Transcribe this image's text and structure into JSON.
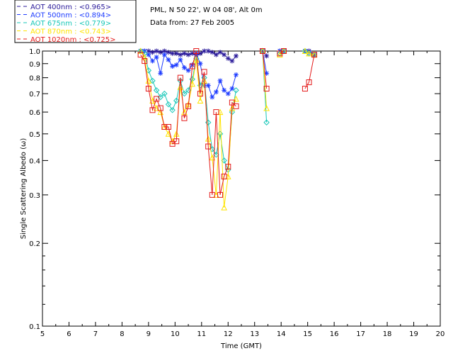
{
  "chart_data": {
    "type": "line",
    "title_lines": [
      "PML, N 50 22', W 04 08', Alt 0m",
      "Data from: 27 Feb 2005"
    ],
    "xlabel": "Time (GMT)",
    "ylabel": "Single Scattering Albedo (ω)",
    "xlim": [
      5,
      20
    ],
    "ylim": [
      0.1,
      1.0
    ],
    "yscale": "log",
    "xticks": [
      "5",
      "6",
      "7",
      "8",
      "9",
      "10",
      "11",
      "12",
      "13",
      "14",
      "15",
      "16",
      "17",
      "18",
      "19",
      "20"
    ],
    "yticks": [
      "0.1",
      "0.2",
      "0.3",
      "0.4",
      "0.5",
      "0.6",
      "0.7",
      "0.8",
      "0.9",
      "1.0"
    ],
    "legend_position": "top-left",
    "series": [
      {
        "name": "AOT  400nm : <0.965>",
        "color": "#2a1a9a",
        "marker": "asterisk",
        "segments": [
          [
            [
              8.7,
              1.0
            ],
            [
              8.85,
              1.0
            ],
            [
              9.0,
              1.0
            ],
            [
              9.15,
              0.99
            ],
            [
              9.3,
              1.0
            ],
            [
              9.45,
              0.99
            ],
            [
              9.6,
              1.0
            ],
            [
              9.75,
              0.99
            ],
            [
              9.9,
              0.98
            ],
            [
              10.05,
              0.98
            ],
            [
              10.2,
              0.97
            ],
            [
              10.35,
              0.98
            ],
            [
              10.5,
              0.97
            ],
            [
              10.65,
              0.98
            ],
            [
              10.8,
              0.97
            ],
            [
              10.95,
              0.98
            ],
            [
              11.1,
              1.0
            ],
            [
              11.25,
              1.0
            ],
            [
              11.4,
              0.99
            ],
            [
              11.55,
              0.97
            ],
            [
              11.7,
              0.99
            ],
            [
              11.85,
              0.97
            ],
            [
              12.0,
              0.94
            ],
            [
              12.15,
              0.92
            ],
            [
              12.3,
              0.96
            ]
          ],
          [
            [
              13.3,
              1.0
            ],
            [
              13.45,
              0.96
            ]
          ],
          [
            [
              13.95,
              1.0
            ],
            [
              14.1,
              1.0
            ]
          ],
          [
            [
              14.9,
              1.0
            ],
            [
              15.05,
              1.0
            ],
            [
              15.25,
              0.97
            ]
          ]
        ]
      },
      {
        "name": "AOT  500nm : <0.894>",
        "color": "#1e3cff",
        "marker": "asterisk",
        "segments": [
          [
            [
              8.7,
              1.0
            ],
            [
              8.85,
              1.0
            ],
            [
              9.0,
              0.97
            ],
            [
              9.15,
              0.92
            ],
            [
              9.3,
              0.95
            ],
            [
              9.45,
              0.83
            ],
            [
              9.6,
              0.97
            ],
            [
              9.75,
              0.93
            ],
            [
              9.9,
              0.88
            ],
            [
              10.05,
              0.89
            ],
            [
              10.2,
              0.93
            ],
            [
              10.35,
              0.87
            ],
            [
              10.5,
              0.85
            ],
            [
              10.65,
              0.89
            ],
            [
              10.8,
              0.98
            ],
            [
              10.95,
              0.9
            ],
            [
              11.1,
              0.75
            ],
            [
              11.25,
              0.75
            ],
            [
              11.4,
              0.68
            ],
            [
              11.55,
              0.71
            ],
            [
              11.7,
              0.78
            ],
            [
              11.85,
              0.72
            ],
            [
              12.0,
              0.7
            ],
            [
              12.15,
              0.73
            ],
            [
              12.3,
              0.82
            ]
          ],
          [
            [
              13.3,
              1.0
            ],
            [
              13.45,
              0.83
            ]
          ],
          [
            [
              13.95,
              1.0
            ],
            [
              14.1,
              1.0
            ]
          ],
          [
            [
              14.9,
              1.0
            ],
            [
              15.05,
              0.99
            ],
            [
              15.25,
              0.97
            ]
          ]
        ]
      },
      {
        "name": "AOT  675nm : <0.779>",
        "color": "#17c7b8",
        "marker": "diamond",
        "segments": [
          [
            [
              8.7,
              1.0
            ],
            [
              8.85,
              0.98
            ],
            [
              9.0,
              0.85
            ],
            [
              9.15,
              0.78
            ],
            [
              9.3,
              0.72
            ],
            [
              9.45,
              0.68
            ],
            [
              9.6,
              0.7
            ],
            [
              9.75,
              0.64
            ],
            [
              9.9,
              0.61
            ],
            [
              10.05,
              0.66
            ],
            [
              10.2,
              0.78
            ],
            [
              10.35,
              0.7
            ],
            [
              10.5,
              0.72
            ],
            [
              10.65,
              0.79
            ],
            [
              10.8,
              0.94
            ],
            [
              10.95,
              0.75
            ],
            [
              11.1,
              0.8
            ],
            [
              11.25,
              0.55
            ],
            [
              11.4,
              0.44
            ],
            [
              11.55,
              0.42
            ],
            [
              11.7,
              0.5
            ],
            [
              11.85,
              0.4
            ],
            [
              12.0,
              0.37
            ],
            [
              12.15,
              0.6
            ],
            [
              12.3,
              0.72
            ]
          ],
          [
            [
              13.3,
              1.0
            ],
            [
              13.45,
              0.55
            ]
          ],
          [
            [
              13.95,
              0.98
            ],
            [
              14.1,
              1.0
            ]
          ],
          [
            [
              14.9,
              1.0
            ],
            [
              15.05,
              0.98
            ],
            [
              15.25,
              0.97
            ]
          ]
        ]
      },
      {
        "name": "AOT  870nm : <0.743>",
        "color": "#ffe400",
        "marker": "triangle",
        "segments": [
          [
            [
              8.7,
              1.0
            ],
            [
              8.85,
              0.95
            ],
            [
              9.0,
              0.78
            ],
            [
              9.15,
              0.66
            ],
            [
              9.3,
              0.62
            ],
            [
              9.45,
              0.6
            ],
            [
              9.6,
              0.53
            ],
            [
              9.75,
              0.5
            ],
            [
              9.9,
              0.47
            ],
            [
              10.05,
              0.5
            ],
            [
              10.2,
              0.74
            ],
            [
              10.35,
              0.6
            ],
            [
              10.5,
              0.64
            ],
            [
              10.65,
              0.76
            ],
            [
              10.8,
              0.93
            ],
            [
              10.95,
              0.66
            ],
            [
              11.1,
              0.78
            ],
            [
              11.25,
              0.48
            ],
            [
              11.4,
              0.41
            ],
            [
              11.55,
              0.3
            ],
            [
              11.7,
              0.6
            ],
            [
              11.85,
              0.27
            ],
            [
              12.0,
              0.35
            ],
            [
              12.15,
              0.62
            ],
            [
              12.3,
              0.67
            ]
          ],
          [
            [
              13.3,
              1.0
            ],
            [
              13.45,
              0.62
            ]
          ],
          [
            [
              13.95,
              0.97
            ],
            [
              14.1,
              1.0
            ]
          ],
          [
            [
              14.9,
              1.0
            ],
            [
              15.05,
              0.98
            ],
            [
              15.25,
              0.97
            ]
          ]
        ]
      },
      {
        "name": "AOT 1020nm : <0.725>",
        "color": "#e41a1a",
        "marker": "square",
        "segments": [
          [
            [
              8.7,
              0.97
            ],
            [
              8.85,
              0.92
            ],
            [
              9.0,
              0.73
            ],
            [
              9.15,
              0.61
            ],
            [
              9.3,
              0.67
            ],
            [
              9.45,
              0.62
            ],
            [
              9.6,
              0.53
            ],
            [
              9.75,
              0.53
            ],
            [
              9.9,
              0.46
            ],
            [
              10.05,
              0.47
            ],
            [
              10.2,
              0.8
            ],
            [
              10.35,
              0.57
            ],
            [
              10.5,
              0.63
            ],
            [
              10.65,
              0.88
            ],
            [
              10.8,
              1.0
            ],
            [
              10.95,
              0.7
            ],
            [
              11.1,
              0.84
            ],
            [
              11.25,
              0.45
            ],
            [
              11.4,
              0.3
            ],
            [
              11.55,
              0.6
            ],
            [
              11.7,
              0.3
            ],
            [
              11.85,
              0.35
            ],
            [
              12.0,
              0.38
            ],
            [
              12.15,
              0.65
            ],
            [
              12.3,
              0.63
            ]
          ],
          [
            [
              13.3,
              1.0
            ],
            [
              13.45,
              0.73
            ]
          ],
          [
            [
              13.95,
              0.98
            ],
            [
              14.1,
              1.0
            ]
          ],
          [
            [
              14.9,
              0.73
            ],
            [
              15.05,
              0.77
            ],
            [
              15.25,
              0.97
            ]
          ]
        ]
      }
    ]
  }
}
